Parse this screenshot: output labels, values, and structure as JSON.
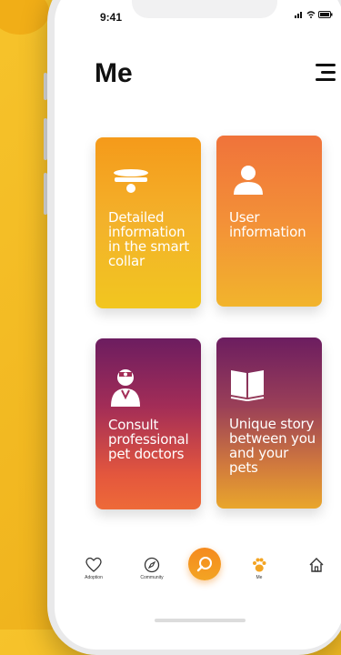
{
  "status_bar": {
    "time": "9:41",
    "signal_icon": "signal-icon",
    "wifi_icon": "wifi-icon",
    "battery_icon": "battery-icon"
  },
  "header": {
    "title": "Me",
    "menu_icon": "hamburger-menu-icon"
  },
  "cards": [
    {
      "label": "Detailed information in the smart collar",
      "icon": "collar-icon"
    },
    {
      "label": "User information",
      "icon": "user-icon"
    },
    {
      "label": "Consult professional pet doctors",
      "icon": "doctor-icon"
    },
    {
      "label": "Unique story between you and your pets",
      "icon": "book-icon"
    }
  ],
  "tabbar": {
    "items": [
      {
        "label": "Adoption",
        "icon": "heart-icon"
      },
      {
        "label": "Community",
        "icon": "compass-icon"
      },
      {
        "label": "Me",
        "icon": "paw-icon",
        "active": true
      },
      {
        "label": "",
        "icon": "home-icon"
      }
    ],
    "center_action_icon": "search-icon"
  },
  "colors": {
    "background": "#f1b61f",
    "accent_orange": "#f58a1e",
    "accent_purple": "#6c1d60"
  }
}
